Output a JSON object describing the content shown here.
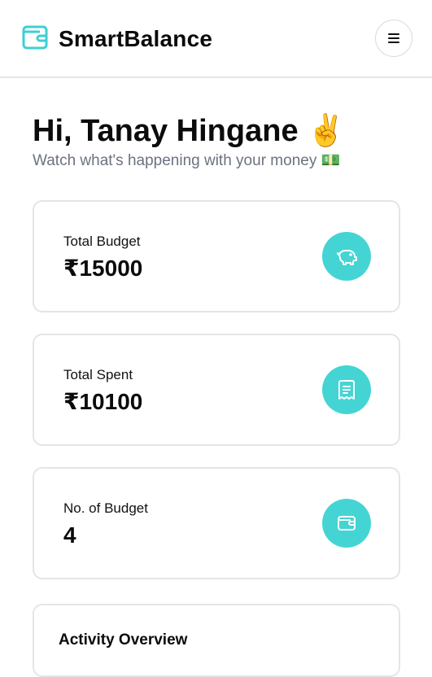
{
  "header": {
    "app_name": "SmartBalance",
    "logo_icon": "wallet-icon",
    "menu_icon": "hamburger-menu-icon"
  },
  "greeting": {
    "title": "Hi, Tanay Hingane ✌️",
    "subtitle": "Watch what's happening with your money 💵"
  },
  "stats": [
    {
      "label": "Total Budget",
      "value": "₹15000",
      "icon": "piggy-bank-icon"
    },
    {
      "label": "Total Spent",
      "value": "₹10100",
      "icon": "receipt-icon"
    },
    {
      "label": "No. of Budget",
      "value": "4",
      "icon": "wallet-icon"
    }
  ],
  "activity": {
    "title": "Activity Overview"
  },
  "colors": {
    "accent": "#45d4d4",
    "border": "#e3e5e8",
    "muted_text": "#6b7280"
  }
}
